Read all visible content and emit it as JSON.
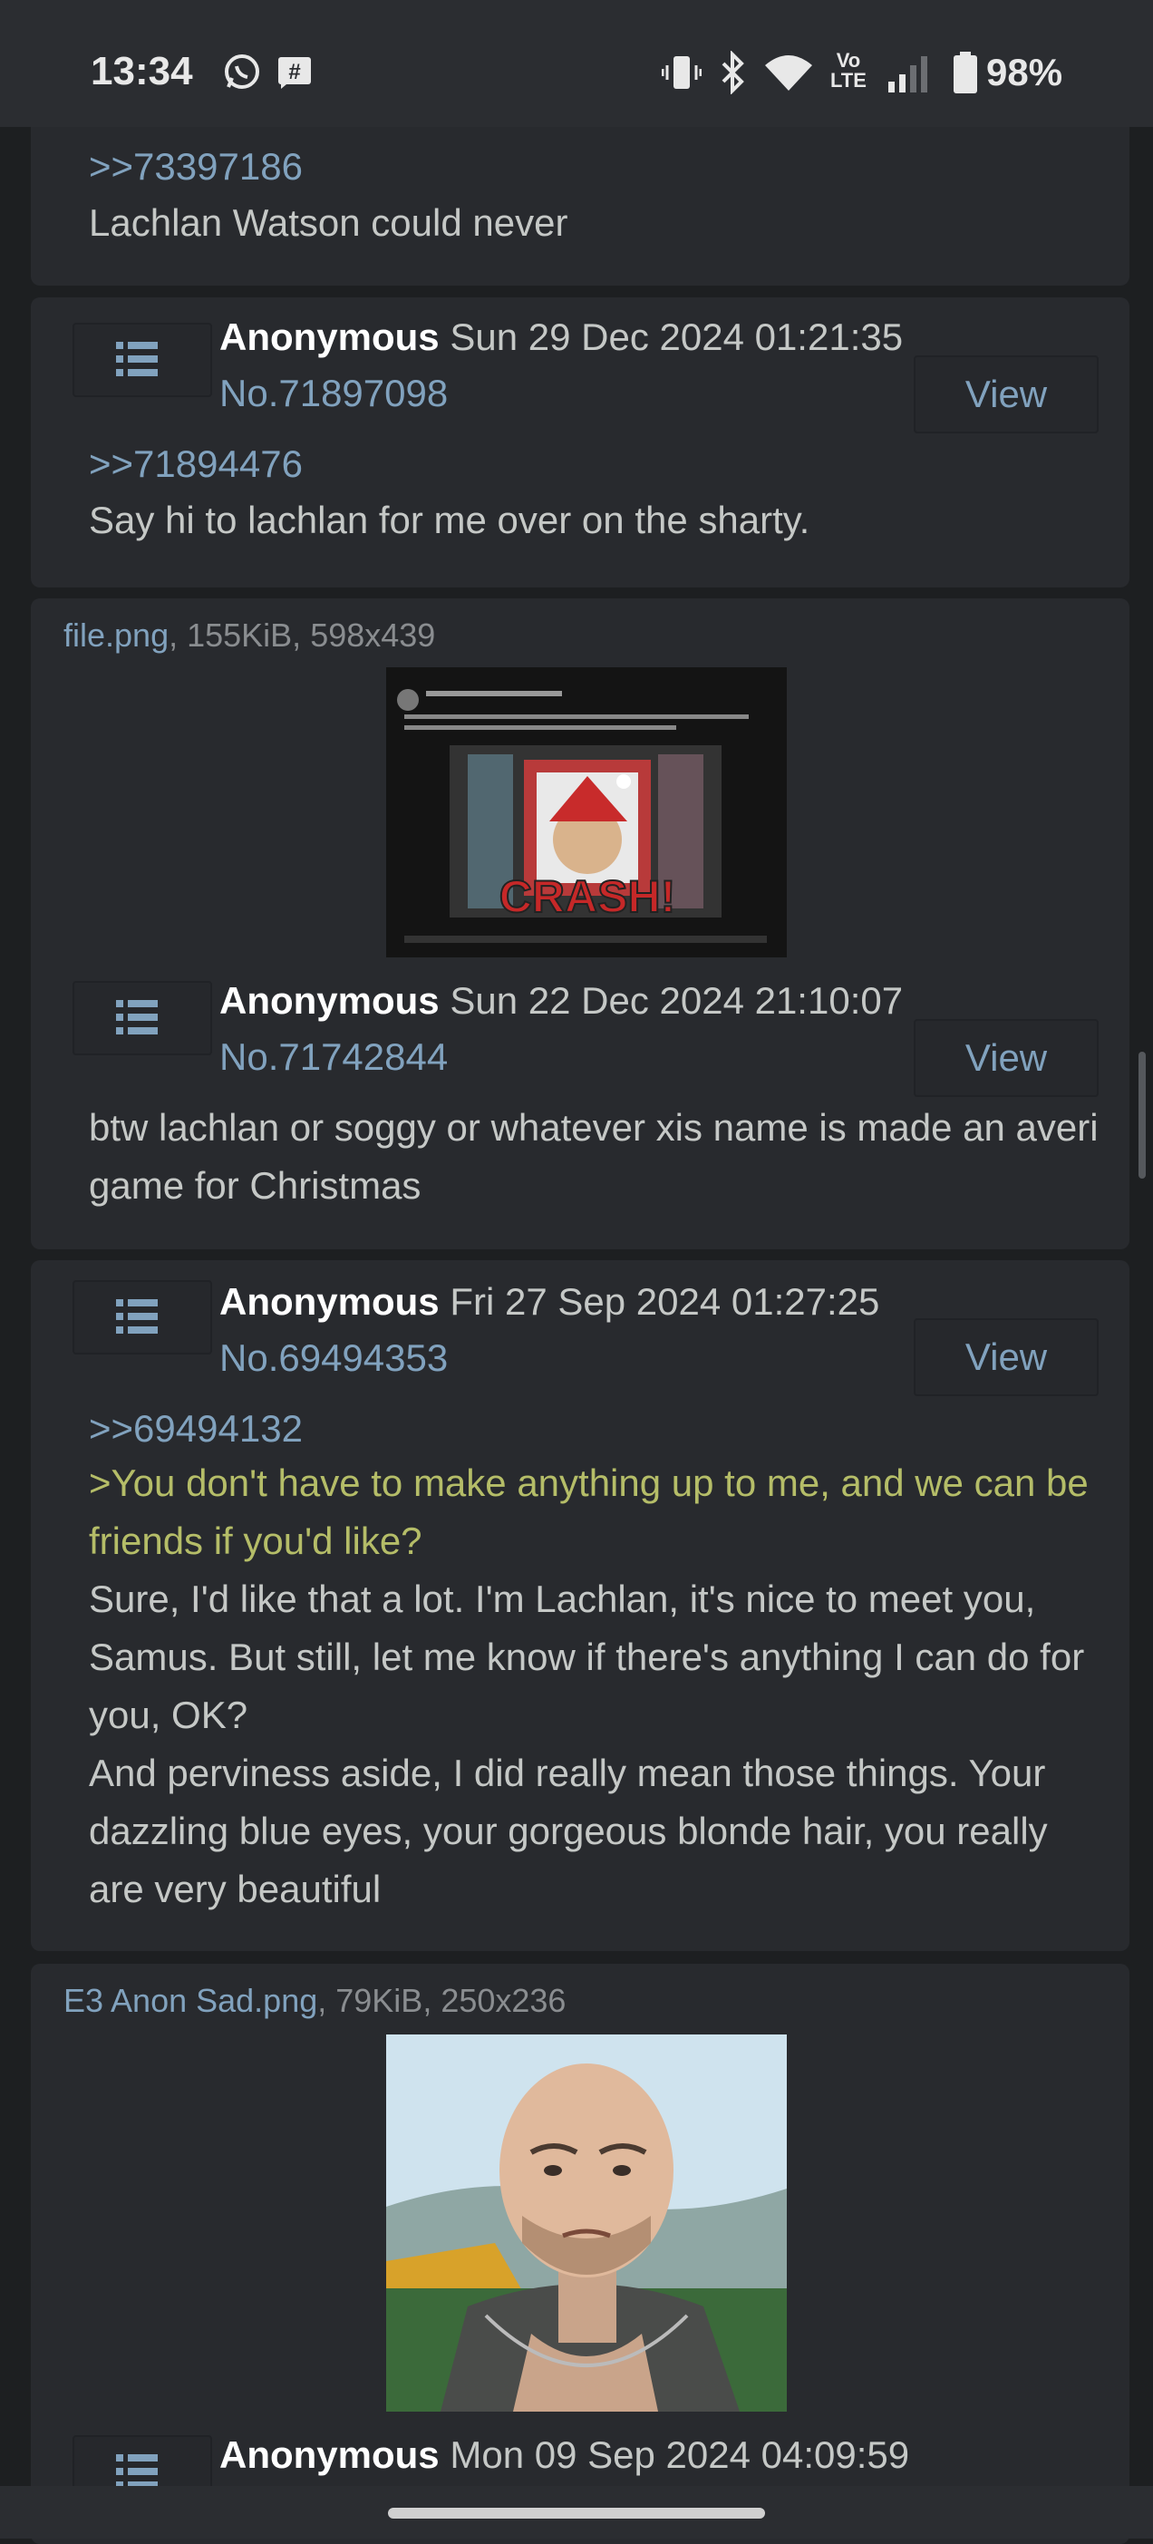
{
  "status_bar": {
    "time": "13:34",
    "icons_left": [
      "whatsapp-icon",
      "hashtag-notification-icon"
    ],
    "icons_right": [
      "vibrate-icon",
      "bluetooth-icon",
      "wifi-icon",
      "volte-icon",
      "signal-icon",
      "battery-icon"
    ],
    "volte_label_1": "Vo",
    "volte_label_2": "LTE",
    "battery": "98%"
  },
  "posts": [
    {
      "quote": ">>73397186",
      "body": "Lachlan Watson could never"
    },
    {
      "name": "Anonymous",
      "date": "Sun 29 Dec 2024 01:21:35",
      "no": "No.71897098",
      "view": "View",
      "quote": ">>71894476",
      "body": "Say hi to lachlan for me over on the sharty."
    },
    {
      "file_name": "file.png",
      "file_meta": ", 155KiB, 598x439",
      "name": "Anonymous",
      "date": "Sun 22 Dec 2024 21:10:07",
      "no": "No.71742844",
      "view": "View",
      "body": "btw lachlan or soggy or whatever xis name is made an averi game for Christmas",
      "thumb_text": "CRASH!"
    },
    {
      "name": "Anonymous",
      "date": "Fri 27 Sep 2024 01:27:25",
      "no": "No.69494353",
      "view": "View",
      "quote": ">>69494132",
      "greentext": ">You don't have to make anything up to me, and we can be friends if you'd like?",
      "body_1": "Sure, I'd like that a lot. I'm Lachlan, it's nice to meet you, Samus. But still, let me know if there's anything I can do for you, OK?",
      "body_2": "And perviness aside, I did really mean those things. Your dazzling blue eyes, your gorgeous blonde hair, you really are very beautiful"
    },
    {
      "file_name": "E3 Anon Sad.png",
      "file_meta": ", 79KiB, 250x236",
      "name": "Anonymous",
      "date": "Mon 09 Sep 2024 04:09:59"
    }
  ],
  "colors": {
    "background": "#1d1f21",
    "post_bg": "#282a2e",
    "link": "#81a2be",
    "greentext": "#b5bd68",
    "text": "#c5c8c6"
  }
}
